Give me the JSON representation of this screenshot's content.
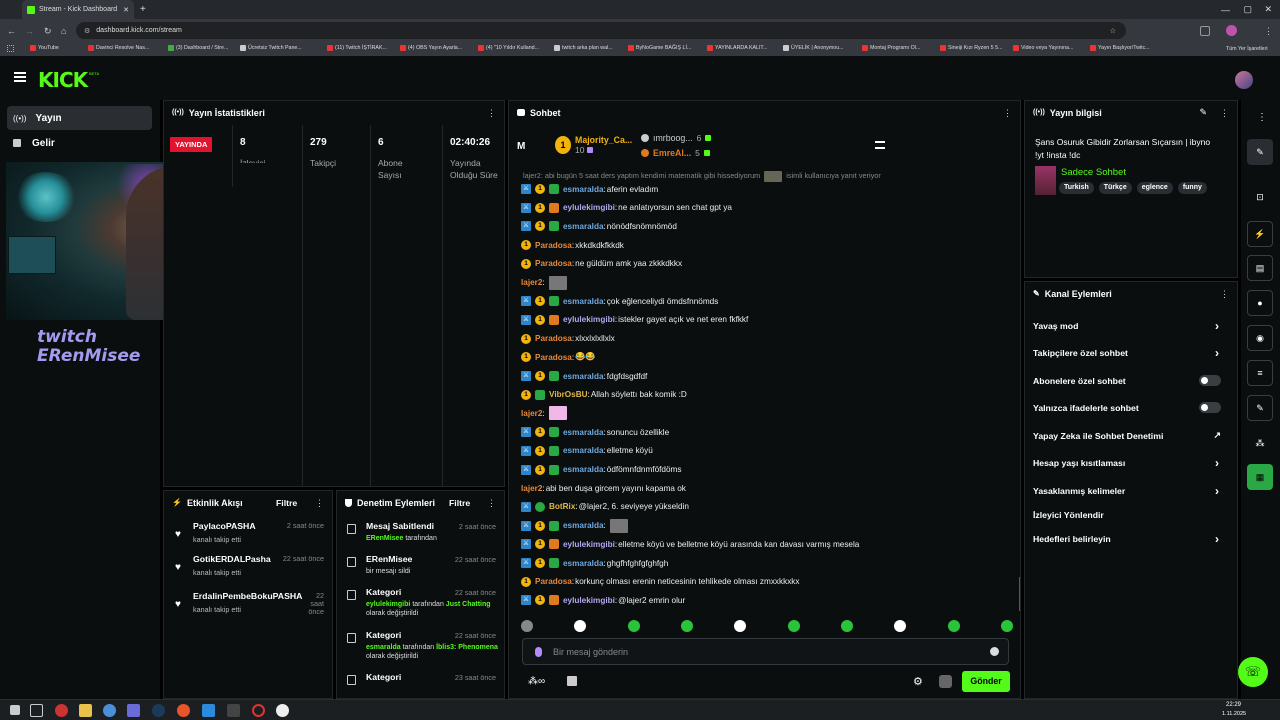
{
  "browser": {
    "tab_title": "Stream - Kick Dashboard",
    "url": "dashboard.kick.com/stream",
    "all_bookmarks": "Tüm Yer İşaretleri",
    "bookmarks": [
      {
        "label": "YouTube"
      },
      {
        "label": "Davinci Resolve Nas..."
      },
      {
        "label": "(3) Dashboard / Stre..."
      },
      {
        "label": "Ücretsiz Twitch Pane..."
      },
      {
        "label": "(11) Twitch İŞTİRAK..."
      },
      {
        "label": "(4) OBS Yayın Ayarla..."
      },
      {
        "label": "(4) \"10 Yıldır Kulland..."
      },
      {
        "label": "twitch arka plan wal..."
      },
      {
        "label": "ByNoGame BAĞIŞ Lİ..."
      },
      {
        "label": "YAYINLARDA KALIT..."
      },
      {
        "label": "ÜYELİK | Anonymou..."
      },
      {
        "label": "Montaj Programı Ol..."
      },
      {
        "label": "Sineiji Kızı Ryzen 5 5..."
      },
      {
        "label": "Video veya Yayınına..."
      },
      {
        "label": "Yayın Başlıyor/Twitc..."
      }
    ]
  },
  "header": {
    "logo": "KICK",
    "beta": "BETA"
  },
  "sidebar": {
    "items": [
      {
        "label": "Yayın",
        "icon": "broadcast-icon"
      },
      {
        "label": "Gelir",
        "icon": "dollar-icon"
      }
    ],
    "watermark": {
      "line1": "twitch",
      "line2": "ERenMisee"
    }
  },
  "stats": {
    "title": "Yayın İstatistikleri",
    "status": "YAYINDA",
    "items": [
      {
        "value": "8",
        "label": "İzleyici"
      },
      {
        "value": "279",
        "label": "Takipçi"
      },
      {
        "value": "6",
        "label": "Abone Sayısı"
      },
      {
        "value": "02:40:26",
        "label": "Yayında Olduğu Süre"
      }
    ]
  },
  "activity": {
    "title": "Etkinlik Akışı",
    "filter": "Filtre",
    "items": [
      {
        "name": "PaylacoPASHA",
        "time": "2 saat önce",
        "desc": "kanalı takip etti"
      },
      {
        "name": "GotikERDALPasha",
        "time": "22 saat önce",
        "desc": "kanalı takip etti"
      },
      {
        "name": "ErdalinPembeBokuPASHA",
        "time": "22 saat önce",
        "desc": "kanalı takip etti"
      }
    ]
  },
  "moderation": {
    "title": "Denetim Eylemleri",
    "filter": "Filtre",
    "items": [
      {
        "title": "Mesaj Sabitlendi",
        "time": "2 saat önce",
        "user": "ERenMisee",
        "text": "tarafından",
        "icon": "pin-icon"
      },
      {
        "title": "ERenMisee",
        "time": "22 saat önce",
        "user": "",
        "text": "bir mesajı sildi",
        "icon": "trash-icon"
      },
      {
        "title": "Kategori",
        "time": "22 saat önce",
        "user": "eylulekimgibi",
        "text": "tarafından",
        "cat": "Just Chatting",
        "text2": "olarak değiştirildi",
        "icon": "category-icon"
      },
      {
        "title": "Kategori",
        "time": "22 saat önce",
        "user": "esmaralda",
        "text": "tarafından",
        "cat": "İblis3: Phenomena",
        "text2": "olarak değiştirildi",
        "icon": "category-icon"
      },
      {
        "title": "Kategori",
        "time": "23 saat önce",
        "user": "",
        "text": "",
        "icon": "category-icon"
      }
    ]
  },
  "chat": {
    "title": "Sohbet",
    "placeholder": "Bir mesaj gönderin",
    "send": "Gönder",
    "top_letter": "M",
    "leaders": [
      {
        "name": "Majority_Ca...",
        "count": "10"
      },
      {
        "name": "ımrboog...",
        "count": "6"
      },
      {
        "name": "EmreAl...",
        "count": "5"
      }
    ],
    "reply_preview": "lajer2: abi bugün 5 saat ders yaptım kendimi matematik gibi hissediyorum",
    "reply_preview2": "isimli kullanıcıya yanıt veriyor",
    "messages": [
      {
        "user": "esmaralda",
        "text": "aferin evladım",
        "badges": "bgu",
        "color": "#6fa8dc"
      },
      {
        "user": "eylulekimgibi",
        "text": "ne anlatıyorsun sen chat gpt ya",
        "badges": "bgo",
        "color": "#b4a7f0"
      },
      {
        "user": "esmaralda",
        "text": "nönödfsnömnömöd",
        "badges": "bgu",
        "color": "#6fa8dc"
      },
      {
        "user": "Paradosa",
        "text": "xkkdkdkfkkdk",
        "badges": "g",
        "color": "#e8883a"
      },
      {
        "user": "Paradosa",
        "text": "ne güldüm amk yaa zkkkdkkx",
        "badges": "g",
        "color": "#e8883a"
      },
      {
        "user": "lajer2",
        "text": "",
        "badges": "",
        "color": "#e8883a",
        "img": true
      },
      {
        "user": "esmaralda",
        "text": "çok eğlenceliydi ömdsfnnömds",
        "badges": "bgu",
        "color": "#6fa8dc"
      },
      {
        "user": "eylulekimgibi",
        "text": "istekler gayet açık ve net eren fkfkkf",
        "badges": "bgo",
        "color": "#b4a7f0"
      },
      {
        "user": "Paradosa",
        "text": "xlxxlxlxllxlx",
        "badges": "g",
        "color": "#e8883a"
      },
      {
        "user": "Paradosa",
        "text": "😂😂",
        "badges": "g",
        "color": "#e8883a"
      },
      {
        "user": "esmaralda",
        "text": "fdgfdsgdfdf",
        "badges": "bgu",
        "color": "#6fa8dc"
      },
      {
        "user": "VibrOsBU",
        "text": "Allah söylettı bak komik :D",
        "badges": "gu",
        "color": "#e0b84a"
      },
      {
        "user": "lajer2",
        "text": "",
        "badges": "",
        "color": "#e8883a",
        "img": true,
        "pink": true
      },
      {
        "user": "esmaralda",
        "text": "sonuncu özellikle",
        "badges": "bgu",
        "color": "#6fa8dc"
      },
      {
        "user": "esmaralda",
        "text": "elletme köyü",
        "badges": "bgu",
        "color": "#6fa8dc"
      },
      {
        "user": "esmaralda",
        "text": "ödfömnfdnmföfdöms",
        "badges": "bgu",
        "color": "#6fa8dc"
      },
      {
        "user": "lajer2",
        "text": "abi ben duşa gircem yayını kapama ok",
        "badges": "",
        "color": "#e8883a"
      },
      {
        "user": "BotRix",
        "text": "@lajer2, 6. seviyeye yükseldin",
        "badges": "bv",
        "color": "#e0b84a"
      },
      {
        "user": "esmaralda",
        "text": "",
        "badges": "bgu",
        "color": "#6fa8dc",
        "img": true
      },
      {
        "user": "eylulekimgibi",
        "text": "elletme köyü ve belletme köyü arasında kan davası varmış mesela",
        "badges": "bgo",
        "color": "#b4a7f0"
      },
      {
        "user": "esmaralda",
        "text": "ghgfhfghfgfghfgh",
        "badges": "bgu",
        "color": "#6fa8dc"
      },
      {
        "user": "Paradosa",
        "text": "korkunç olması erenin neticesinin tehlikede olması zmxxkkxkx",
        "badges": "g",
        "color": "#e8883a"
      },
      {
        "user": "eylulekimgibi",
        "text": "@lajer2 emrin olur",
        "badges": "bgo",
        "color": "#b4a7f0"
      }
    ]
  },
  "stream_info": {
    "title": "Yayın bilgisi",
    "stream_title": "Şans Osuruk Gibidir Zorlarsan Sıçarsın | ibyno !yt !insta !dc",
    "category": "Sadece Sohbet",
    "tags": [
      "Turkish",
      "Türkçe",
      "eglence",
      "funny"
    ]
  },
  "channel_actions": {
    "title": "Kanal Eylemleri",
    "items": [
      {
        "label": "Yavaş mod",
        "ctrl": "chevron"
      },
      {
        "label": "Takipçilere özel sohbet",
        "ctrl": "chevron"
      },
      {
        "label": "Abonelere özel sohbet",
        "ctrl": "toggle"
      },
      {
        "label": "Yalnızca ifadelerle sohbet",
        "ctrl": "toggle"
      },
      {
        "label": "Yapay Zeka ile Sohbet Denetimi",
        "ctrl": "external"
      },
      {
        "label": "Hesap yaşı kısıtlaması",
        "ctrl": "chevron"
      },
      {
        "label": "Yasaklanmış kelimeler",
        "ctrl": "chevron"
      },
      {
        "label": "İzleyici Yönlendir",
        "ctrl": "none"
      },
      {
        "label": "Hedefleri belirleyin",
        "ctrl": "chevron"
      }
    ]
  },
  "taskbar": {
    "time": "22:29",
    "date": "1.11.2025"
  },
  "colors": {
    "kick_green": "#53fc18",
    "live_red": "#e1132d",
    "panel_bg": "#0b0e0f"
  }
}
